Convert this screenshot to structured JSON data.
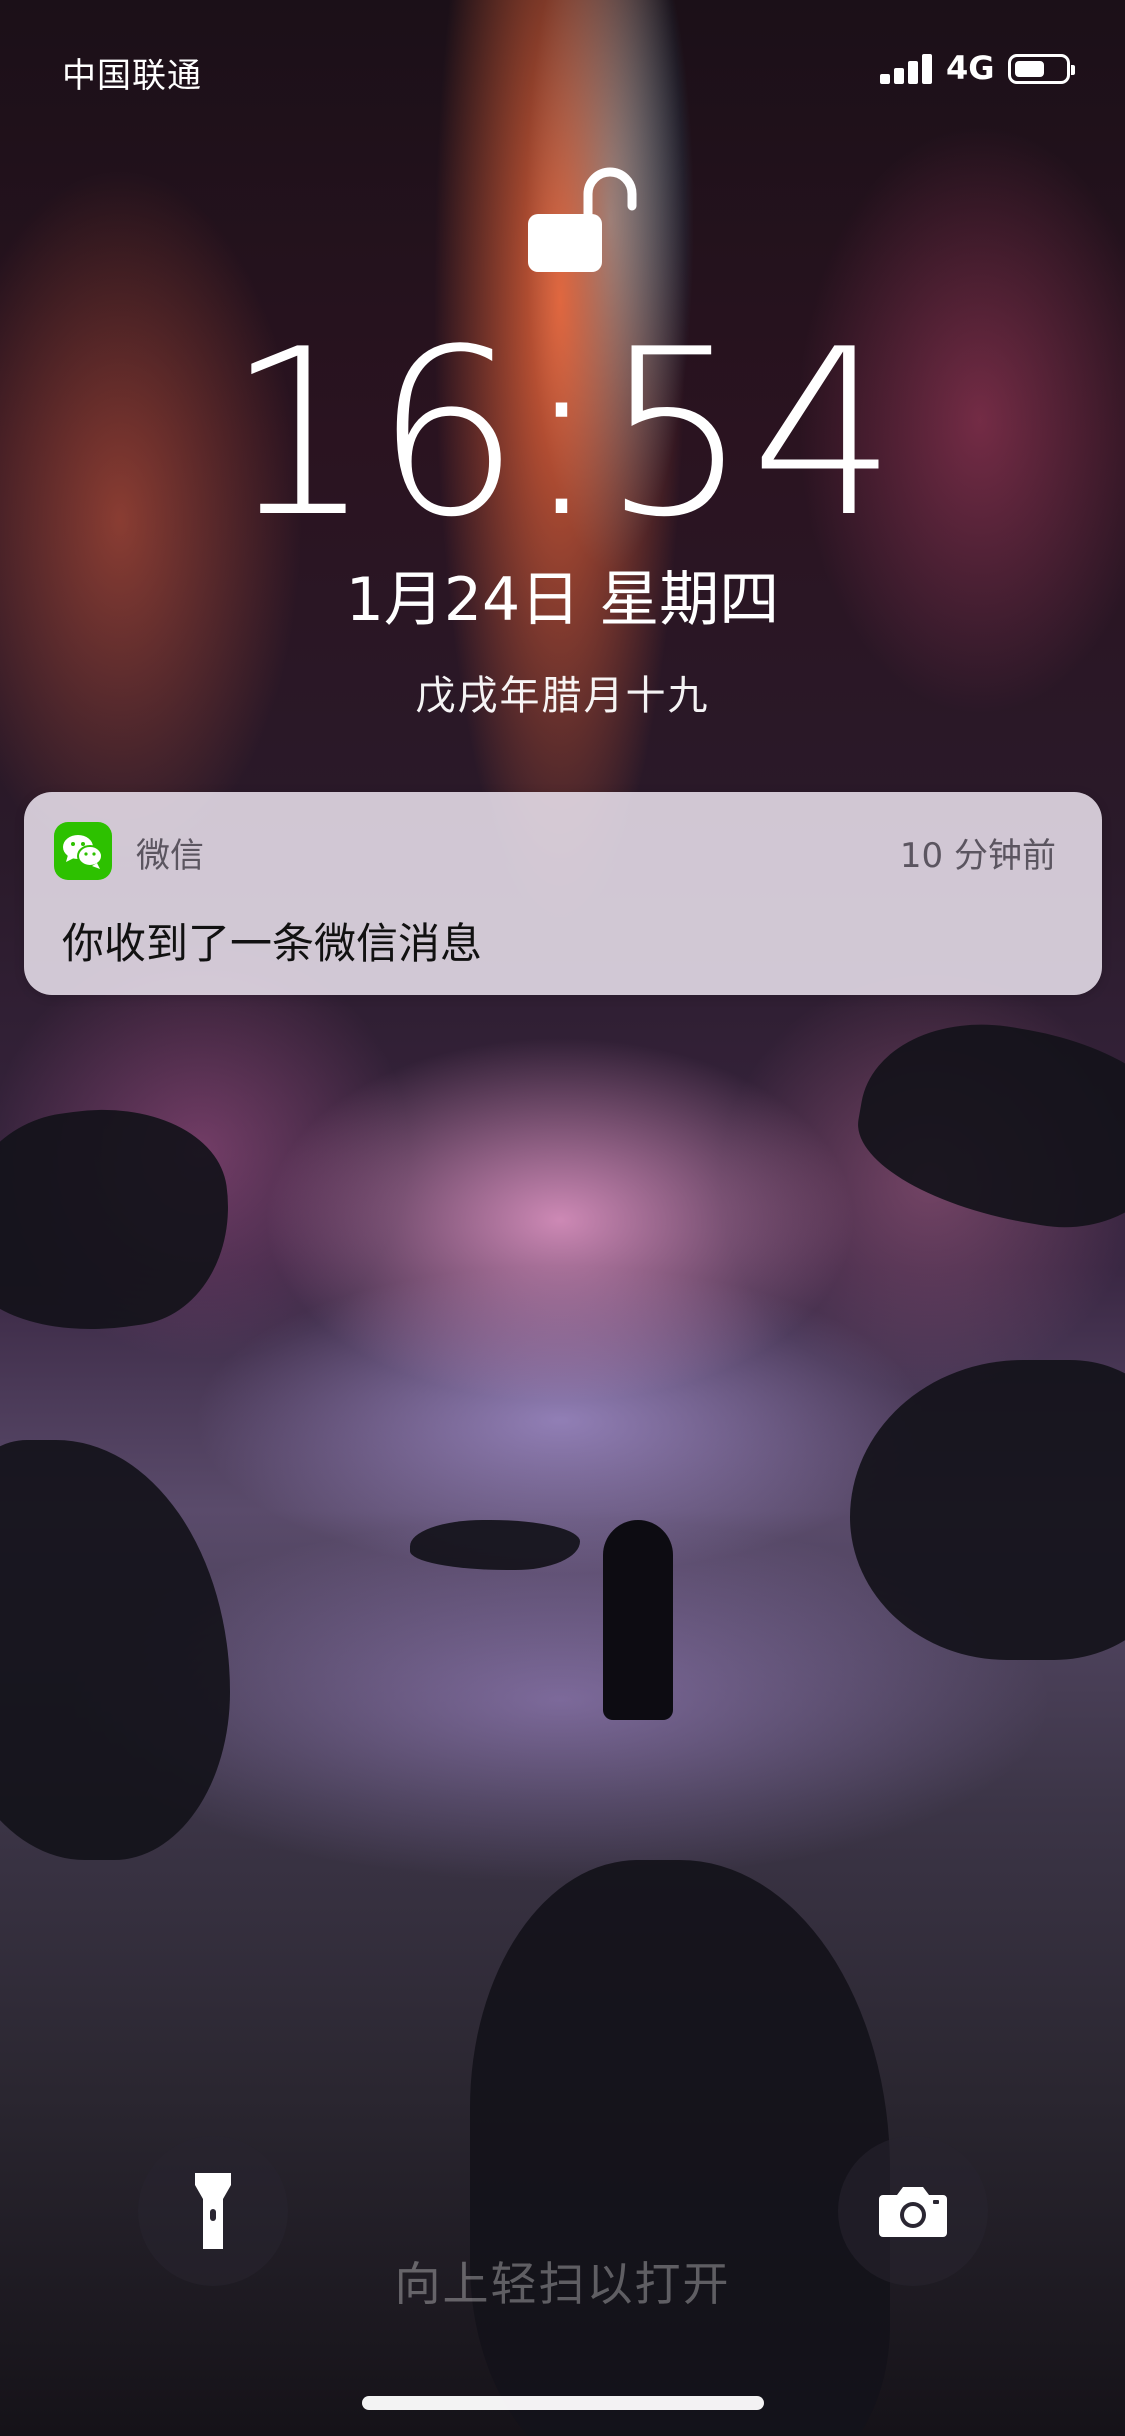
{
  "status_bar": {
    "carrier": "中国联通",
    "network": "4G",
    "battery_level": 0.6,
    "signal_bars": 4
  },
  "lock_screen": {
    "time": "16:54",
    "date": "1月24日 星期四",
    "lunar_date": "戊戌年腊月十九"
  },
  "notification": {
    "app_name": "微信",
    "time_ago": "10 分钟前",
    "message": "你收到了一条微信消息",
    "app_color": "#2DC100"
  },
  "bottom": {
    "swipe_hint": "向上轻扫以打开",
    "left_button_icon": "flashlight-icon",
    "right_button_icon": "camera-icon"
  }
}
